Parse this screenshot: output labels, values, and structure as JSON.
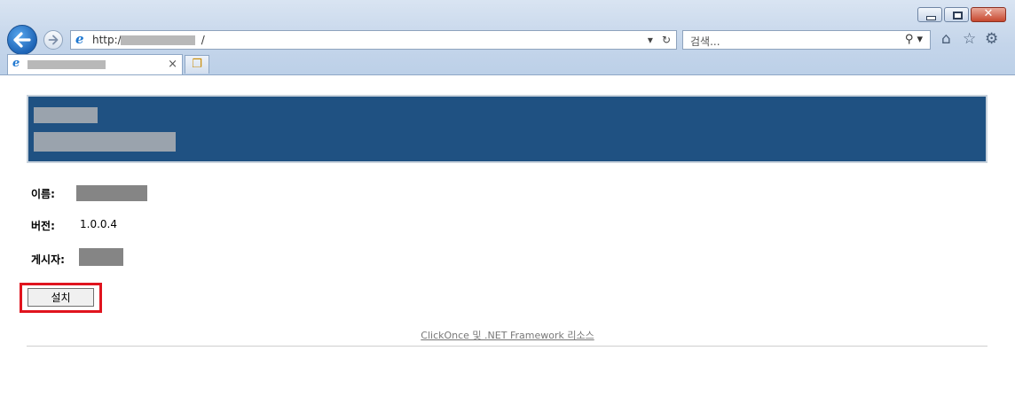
{
  "browser": {
    "address_prefix": "http://",
    "address_suffix": "/",
    "search_placeholder": "검색...",
    "tab_close": "×"
  },
  "page": {
    "fields": [
      {
        "label": "이름:"
      },
      {
        "label": "버전:",
        "value": "1.0.0.4"
      },
      {
        "label": "게시자:"
      }
    ],
    "install_label": "설치",
    "resources_link": "ClickOnce 및 .NET Framework 리소스"
  },
  "colors": {
    "banner": "#1f5182",
    "highlight": "#e0141e"
  }
}
